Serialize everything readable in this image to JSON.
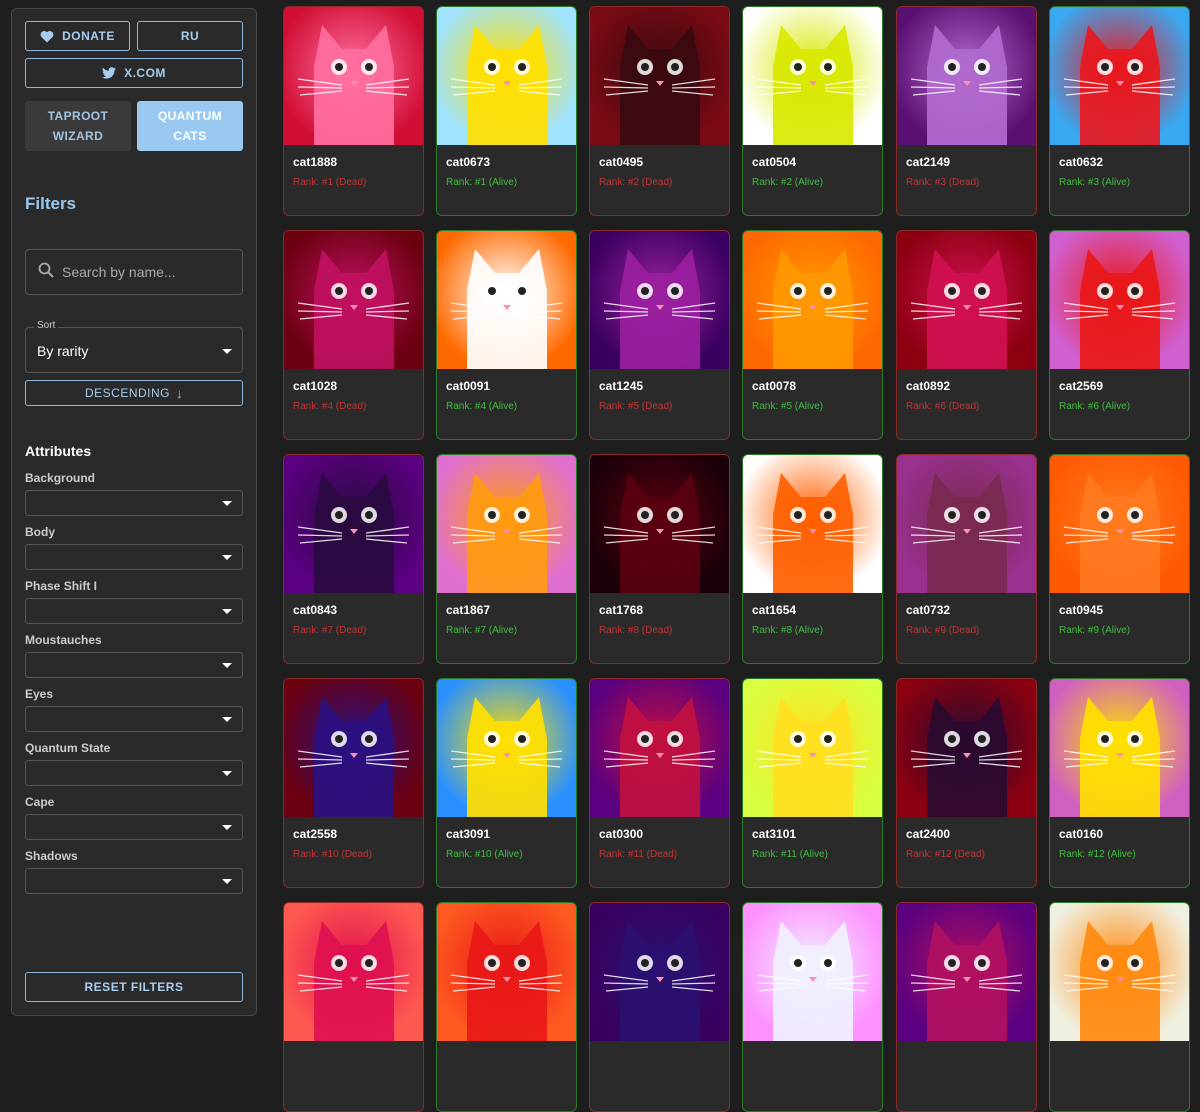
{
  "sidebar": {
    "donate": "DONATE",
    "ru": "RU",
    "xcom": "X.COM",
    "tab_taproot_line1": "TAPROOT",
    "tab_taproot_line2": "WIZARD",
    "tab_quantum_line1": "QUANTUM",
    "tab_quantum_line2": "CATS",
    "filters_title": "Filters",
    "search_placeholder": "Search by name...",
    "sort_label": "Sort",
    "sort_value": "By rarity",
    "order": "DESCENDING",
    "order_icon": "↓",
    "attributes_title": "Attributes",
    "attributes": [
      "Background",
      "Body",
      "Phase Shift I",
      "Moustauches",
      "Eyes",
      "Quantum State",
      "Cape",
      "Shadows"
    ],
    "reset": "RESET FILTERS"
  },
  "colors": {
    "accent": "#99c9f0",
    "dead": "#c23434",
    "alive": "#3fbf3f"
  },
  "cards": [
    {
      "name": "cat1888",
      "rank": "Rank: #1 (Dead)",
      "status": "dead",
      "bg": "#d10f35",
      "body": "#ff6fa0"
    },
    {
      "name": "cat0673",
      "rank": "Rank: #1 (Alive)",
      "status": "alive",
      "bg": "#9fe3ff",
      "body": "#ffe000"
    },
    {
      "name": "cat0495",
      "rank": "Rank: #2 (Dead)",
      "status": "dead",
      "bg": "#7a0a14",
      "body": "#3a0a10"
    },
    {
      "name": "cat0504",
      "rank": "Rank: #2 (Alive)",
      "status": "alive",
      "bg": "#ffffff",
      "body": "#d8e800"
    },
    {
      "name": "cat2149",
      "rank": "Rank: #3 (Dead)",
      "status": "dead",
      "bg": "#5a1070",
      "body": "#b06ad0"
    },
    {
      "name": "cat0632",
      "rank": "Rank: #3 (Alive)",
      "status": "alive",
      "bg": "#3aa8f0",
      "body": "#e8181e"
    },
    {
      "name": "cat1028",
      "rank": "Rank: #4 (Dead)",
      "status": "dead",
      "bg": "#6a0010",
      "body": "#c01060"
    },
    {
      "name": "cat0091",
      "rank": "Rank: #4 (Alive)",
      "status": "alive",
      "bg": "#ff6a00",
      "body": "#ffffff"
    },
    {
      "name": "cat1245",
      "rank": "Rank: #5 (Dead)",
      "status": "dead",
      "bg": "#3a0060",
      "body": "#9a20a0"
    },
    {
      "name": "cat0078",
      "rank": "Rank: #5 (Alive)",
      "status": "alive",
      "bg": "#ff6800",
      "body": "#ff9800"
    },
    {
      "name": "cat0892",
      "rank": "Rank: #6 (Dead)",
      "status": "dead",
      "bg": "#8a0010",
      "body": "#d01050"
    },
    {
      "name": "cat2569",
      "rank": "Rank: #6 (Alive)",
      "status": "alive",
      "bg": "#d060d0",
      "body": "#e81818"
    },
    {
      "name": "cat0843",
      "rank": "Rank: #7 (Dead)",
      "status": "dead",
      "bg": "#5a0080",
      "body": "#2a0a40"
    },
    {
      "name": "cat1867",
      "rank": "Rank: #7 (Alive)",
      "status": "alive",
      "bg": "#e070d0",
      "body": "#ff9a10"
    },
    {
      "name": "cat1768",
      "rank": "Rank: #8 (Dead)",
      "status": "dead",
      "bg": "#1a0008",
      "body": "#5a0010"
    },
    {
      "name": "cat1654",
      "rank": "Rank: #8 (Alive)",
      "status": "alive",
      "bg": "#ffffff",
      "body": "#ff6000"
    },
    {
      "name": "cat0732",
      "rank": "Rank: #9 (Dead)",
      "status": "dead",
      "bg": "#9a3090",
      "body": "#7a2a50"
    },
    {
      "name": "cat0945",
      "rank": "Rank: #9 (Alive)",
      "status": "alive",
      "bg": "#ff5a00",
      "body": "#ff7a20"
    },
    {
      "name": "cat2558",
      "rank": "Rank: #10 (Dead)",
      "status": "dead",
      "bg": "#6a0010",
      "body": "#2a1080"
    },
    {
      "name": "cat3091",
      "rank": "Rank: #10 (Alive)",
      "status": "alive",
      "bg": "#2a90ff",
      "body": "#ffe000"
    },
    {
      "name": "cat0300",
      "rank": "Rank: #11 (Dead)",
      "status": "dead",
      "bg": "#5a0080",
      "body": "#c01040"
    },
    {
      "name": "cat3101",
      "rank": "Rank: #11 (Alive)",
      "status": "alive",
      "bg": "#d8ff40",
      "body": "#ffe020"
    },
    {
      "name": "cat2400",
      "rank": "Rank: #12 (Dead)",
      "status": "dead",
      "bg": "#8a0010",
      "body": "#2a0a30"
    },
    {
      "name": "cat0160",
      "rank": "Rank: #12 (Alive)",
      "status": "alive",
      "bg": "#d060c0",
      "body": "#ffe000"
    },
    {
      "name": "",
      "rank": "",
      "status": "dead",
      "bg": "#ff5a50",
      "body": "#e01050"
    },
    {
      "name": "",
      "rank": "",
      "status": "alive",
      "bg": "#ff5a20",
      "body": "#e81818"
    },
    {
      "name": "",
      "rank": "",
      "status": "dead",
      "bg": "#3a0060",
      "body": "#2a1070"
    },
    {
      "name": "",
      "rank": "",
      "status": "alive",
      "bg": "#ff90ff",
      "body": "#f0f0ff"
    },
    {
      "name": "",
      "rank": "",
      "status": "dead",
      "bg": "#5a0080",
      "body": "#b01060"
    },
    {
      "name": "",
      "rank": "",
      "status": "alive",
      "bg": "#f0f0e0",
      "body": "#ff8a10"
    }
  ]
}
